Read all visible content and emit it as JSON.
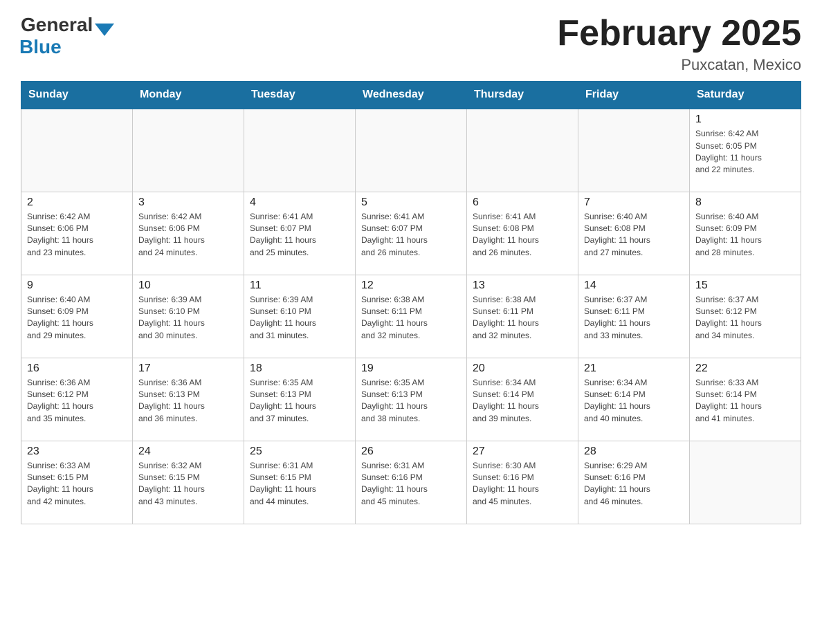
{
  "header": {
    "logo_general": "General",
    "logo_blue": "Blue",
    "title": "February 2025",
    "subtitle": "Puxcatan, Mexico"
  },
  "weekdays": [
    "Sunday",
    "Monday",
    "Tuesday",
    "Wednesday",
    "Thursday",
    "Friday",
    "Saturday"
  ],
  "weeks": [
    [
      {
        "day": "",
        "info": ""
      },
      {
        "day": "",
        "info": ""
      },
      {
        "day": "",
        "info": ""
      },
      {
        "day": "",
        "info": ""
      },
      {
        "day": "",
        "info": ""
      },
      {
        "day": "",
        "info": ""
      },
      {
        "day": "1",
        "info": "Sunrise: 6:42 AM\nSunset: 6:05 PM\nDaylight: 11 hours\nand 22 minutes."
      }
    ],
    [
      {
        "day": "2",
        "info": "Sunrise: 6:42 AM\nSunset: 6:06 PM\nDaylight: 11 hours\nand 23 minutes."
      },
      {
        "day": "3",
        "info": "Sunrise: 6:42 AM\nSunset: 6:06 PM\nDaylight: 11 hours\nand 24 minutes."
      },
      {
        "day": "4",
        "info": "Sunrise: 6:41 AM\nSunset: 6:07 PM\nDaylight: 11 hours\nand 25 minutes."
      },
      {
        "day": "5",
        "info": "Sunrise: 6:41 AM\nSunset: 6:07 PM\nDaylight: 11 hours\nand 26 minutes."
      },
      {
        "day": "6",
        "info": "Sunrise: 6:41 AM\nSunset: 6:08 PM\nDaylight: 11 hours\nand 26 minutes."
      },
      {
        "day": "7",
        "info": "Sunrise: 6:40 AM\nSunset: 6:08 PM\nDaylight: 11 hours\nand 27 minutes."
      },
      {
        "day": "8",
        "info": "Sunrise: 6:40 AM\nSunset: 6:09 PM\nDaylight: 11 hours\nand 28 minutes."
      }
    ],
    [
      {
        "day": "9",
        "info": "Sunrise: 6:40 AM\nSunset: 6:09 PM\nDaylight: 11 hours\nand 29 minutes."
      },
      {
        "day": "10",
        "info": "Sunrise: 6:39 AM\nSunset: 6:10 PM\nDaylight: 11 hours\nand 30 minutes."
      },
      {
        "day": "11",
        "info": "Sunrise: 6:39 AM\nSunset: 6:10 PM\nDaylight: 11 hours\nand 31 minutes."
      },
      {
        "day": "12",
        "info": "Sunrise: 6:38 AM\nSunset: 6:11 PM\nDaylight: 11 hours\nand 32 minutes."
      },
      {
        "day": "13",
        "info": "Sunrise: 6:38 AM\nSunset: 6:11 PM\nDaylight: 11 hours\nand 32 minutes."
      },
      {
        "day": "14",
        "info": "Sunrise: 6:37 AM\nSunset: 6:11 PM\nDaylight: 11 hours\nand 33 minutes."
      },
      {
        "day": "15",
        "info": "Sunrise: 6:37 AM\nSunset: 6:12 PM\nDaylight: 11 hours\nand 34 minutes."
      }
    ],
    [
      {
        "day": "16",
        "info": "Sunrise: 6:36 AM\nSunset: 6:12 PM\nDaylight: 11 hours\nand 35 minutes."
      },
      {
        "day": "17",
        "info": "Sunrise: 6:36 AM\nSunset: 6:13 PM\nDaylight: 11 hours\nand 36 minutes."
      },
      {
        "day": "18",
        "info": "Sunrise: 6:35 AM\nSunset: 6:13 PM\nDaylight: 11 hours\nand 37 minutes."
      },
      {
        "day": "19",
        "info": "Sunrise: 6:35 AM\nSunset: 6:13 PM\nDaylight: 11 hours\nand 38 minutes."
      },
      {
        "day": "20",
        "info": "Sunrise: 6:34 AM\nSunset: 6:14 PM\nDaylight: 11 hours\nand 39 minutes."
      },
      {
        "day": "21",
        "info": "Sunrise: 6:34 AM\nSunset: 6:14 PM\nDaylight: 11 hours\nand 40 minutes."
      },
      {
        "day": "22",
        "info": "Sunrise: 6:33 AM\nSunset: 6:14 PM\nDaylight: 11 hours\nand 41 minutes."
      }
    ],
    [
      {
        "day": "23",
        "info": "Sunrise: 6:33 AM\nSunset: 6:15 PM\nDaylight: 11 hours\nand 42 minutes."
      },
      {
        "day": "24",
        "info": "Sunrise: 6:32 AM\nSunset: 6:15 PM\nDaylight: 11 hours\nand 43 minutes."
      },
      {
        "day": "25",
        "info": "Sunrise: 6:31 AM\nSunset: 6:15 PM\nDaylight: 11 hours\nand 44 minutes."
      },
      {
        "day": "26",
        "info": "Sunrise: 6:31 AM\nSunset: 6:16 PM\nDaylight: 11 hours\nand 45 minutes."
      },
      {
        "day": "27",
        "info": "Sunrise: 6:30 AM\nSunset: 6:16 PM\nDaylight: 11 hours\nand 45 minutes."
      },
      {
        "day": "28",
        "info": "Sunrise: 6:29 AM\nSunset: 6:16 PM\nDaylight: 11 hours\nand 46 minutes."
      },
      {
        "day": "",
        "info": ""
      }
    ]
  ]
}
